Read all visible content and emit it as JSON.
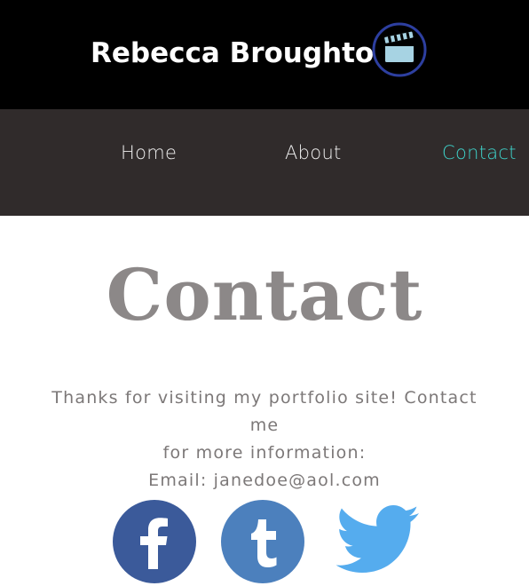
{
  "header": {
    "title": "Rebecca Broughton",
    "logo_icon": "clapperboard-icon",
    "background_color": "#000000"
  },
  "nav": {
    "items": [
      {
        "label": "Home"
      },
      {
        "label": "About"
      },
      {
        "label": "Contact",
        "active": true
      }
    ],
    "background_color": "#302b2b",
    "active_color": "#3ed0c8"
  },
  "main": {
    "heading": "Contact",
    "message_lines": [
      "Thanks for visiting my portfolio site! Contact me",
      "for more information:",
      "Email: janedoe@aol.com"
    ]
  },
  "social": {
    "facebook_icon": "facebook-icon",
    "tumblr_icon": "tumblr-icon",
    "twitter_icon": "twitter-icon",
    "facebook_color": "#3b5a9a",
    "tumblr_color": "#4c80bd",
    "twitter_color": "#55acee"
  }
}
